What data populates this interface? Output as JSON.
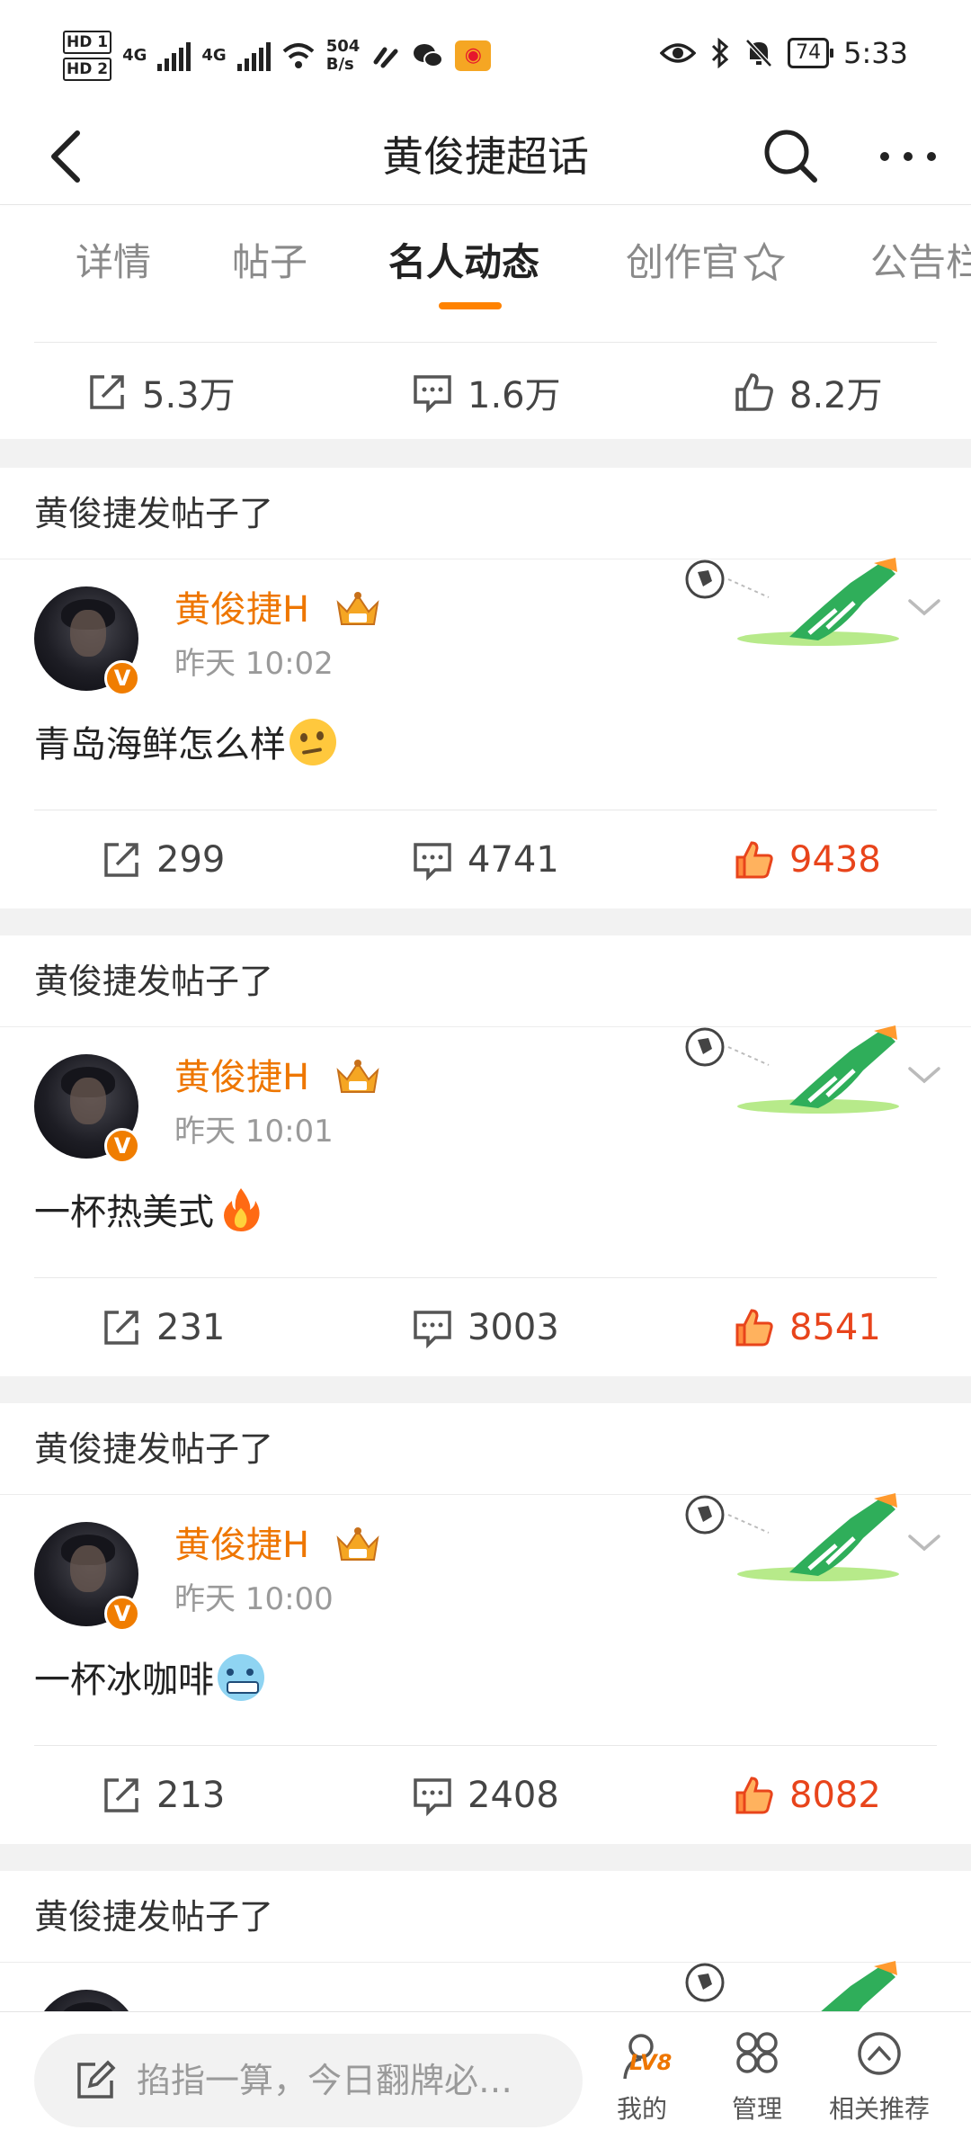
{
  "status_bar": {
    "hd1": "HD 1",
    "hd2": "HD 2",
    "net1": "4G",
    "net2": "4G",
    "speed_value": "504",
    "speed_unit": "B/s",
    "battery": "74",
    "time": "5:33"
  },
  "header": {
    "title": "黄俊捷超话"
  },
  "tabs": [
    {
      "label": "详情"
    },
    {
      "label": "帖子"
    },
    {
      "label": "名人动态"
    },
    {
      "label": "创作官"
    },
    {
      "label": "公告栏"
    }
  ],
  "top_stats": {
    "reposts": "5.3万",
    "comments": "1.6万",
    "likes": "8.2万"
  },
  "posts": [
    {
      "section": "黄俊捷发帖子了",
      "author": "黄俊捷H",
      "time": "昨天 10:02",
      "text": "青岛海鲜怎么样",
      "emoji": "thinking-face",
      "reposts": "299",
      "comments": "4741",
      "likes": "9438"
    },
    {
      "section": "黄俊捷发帖子了",
      "author": "黄俊捷H",
      "time": "昨天 10:01",
      "text": "一杯热美式",
      "emoji": "fire",
      "reposts": "231",
      "comments": "3003",
      "likes": "8541"
    },
    {
      "section": "黄俊捷发帖子了",
      "author": "黄俊捷H",
      "time": "昨天 10:00",
      "text": "一杯冰咖啡",
      "emoji": "cold-face",
      "reposts": "213",
      "comments": "2408",
      "likes": "8082"
    },
    {
      "section": "黄俊捷发帖子了"
    }
  ],
  "bottom_bar": {
    "compose_placeholder": "掐指一算，今日翻牌必…",
    "level_badge": "LV8",
    "mine_label": "我的",
    "manage_label": "管理",
    "recommend_label": "相关推荐"
  },
  "colors": {
    "accent": "#ff8200",
    "username": "#ee7600",
    "liked": "#e8441b",
    "feed_bg": "#f2f2f2"
  }
}
